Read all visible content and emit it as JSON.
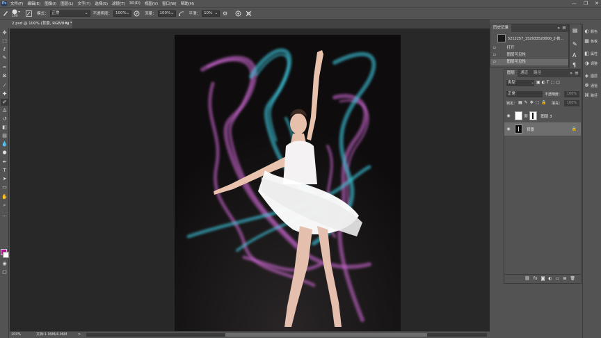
{
  "menubar": {
    "items": [
      "文件(F)",
      "编辑(E)",
      "图像(I)",
      "图层(L)",
      "文字(Y)",
      "选择(S)",
      "滤镜(T)",
      "3D(D)",
      "视图(V)",
      "窗口(W)",
      "帮助(H)"
    ],
    "ps_label": "Ps"
  },
  "window_controls": {
    "minimize": "—",
    "restore": "❐",
    "close": "✕"
  },
  "options_bar": {
    "brush_size": "100",
    "mode_label": "模式：",
    "mode_value": "正常",
    "opacity_label": "不透明度：",
    "opacity_value": "100%",
    "flow_label": "流量：",
    "flow_value": "100%",
    "smooth_label": "平滑：",
    "smooth_value": "10%"
  },
  "document_tab": {
    "title": "2.psd @ 100% (背景, RGB/8#) *",
    "close": "×"
  },
  "status_bar": {
    "zoom": "100%",
    "doc_info": "文档:1.99M/4.96M",
    "arrow": ">"
  },
  "history_panel": {
    "tab_label": "历史记录",
    "snapshot_name": "5212257_152933520000_2-数...",
    "items": [
      "打开",
      "图层可见性",
      "图层可见性"
    ]
  },
  "layers_panel": {
    "tabs": [
      "图层",
      "通道",
      "路径"
    ],
    "kind_filter": "类型",
    "blend_mode": "正常",
    "opacity_label": "不透明度：",
    "opacity_value": "100%",
    "lock_label": "锁定：",
    "fill_label": "填充：",
    "fill_value": "100%",
    "layers": [
      {
        "name": "图层 3",
        "visible": true,
        "selected": false
      },
      {
        "name": "背景",
        "visible": true,
        "selected": true
      }
    ]
  },
  "far_strip": {
    "items": [
      "颜色",
      "色板",
      "属性",
      "调整",
      "图层",
      "通道",
      "路径"
    ]
  },
  "colors": {
    "foreground": "#b0128a",
    "background": "#ffffff",
    "ribbon_pink": "#d46ad8",
    "ribbon_cyan": "#3ec8e0"
  }
}
